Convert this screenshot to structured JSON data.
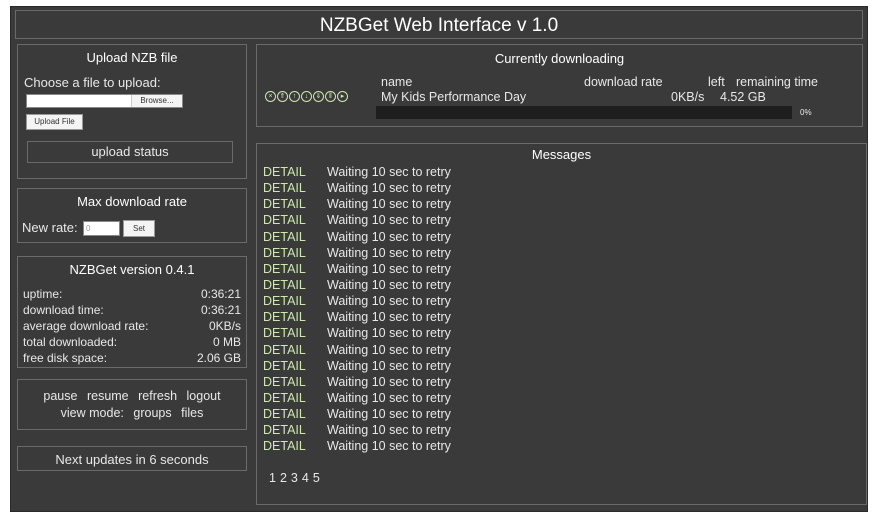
{
  "title": "NZBGet Web Interface v 1.0",
  "upload": {
    "title": "Upload NZB file",
    "choose_label": "Choose a file to upload:",
    "browse_label": "Browse...",
    "upload_button": "Upload File",
    "status": "upload status"
  },
  "rate": {
    "title": "Max download rate",
    "label": "New rate:",
    "value": "0",
    "set_button": "Set"
  },
  "stats": {
    "title": "NZBGet version 0.4.1",
    "rows": [
      {
        "label": "uptime:",
        "value": "0:36:21"
      },
      {
        "label": "download time:",
        "value": "0:36:21"
      },
      {
        "label": "average download rate:",
        "value": "0KB/s"
      },
      {
        "label": "total downloaded:",
        "value": "0 MB"
      },
      {
        "label": "free disk space:",
        "value": "2.06 GB"
      }
    ]
  },
  "actions": {
    "pause": "pause",
    "resume": "resume",
    "refresh": "refresh",
    "logout": "logout",
    "view_mode_label": "view mode:",
    "groups": "groups",
    "files": "files"
  },
  "updates": "Next updates in 6 seconds",
  "download": {
    "title": "Currently downloading",
    "col_name": "name",
    "col_rate": "download rate",
    "col_left": "left",
    "col_time": "remaining time",
    "item": {
      "name": "My Kids Performance Day",
      "rate": "0KB/s",
      "left": "4.52 GB",
      "progress_label": "0%",
      "progress": 0
    },
    "icons": [
      "cancel-icon",
      "move-top-icon",
      "move-up-icon",
      "move-down-icon",
      "move-bottom-icon",
      "pause-icon",
      "resume-icon"
    ]
  },
  "messages": {
    "title": "Messages",
    "items": [
      {
        "kind": "DETAIL",
        "text": "Waiting 10 sec to retry"
      },
      {
        "kind": "DETAIL",
        "text": "Waiting 10 sec to retry"
      },
      {
        "kind": "DETAIL",
        "text": "Waiting 10 sec to retry"
      },
      {
        "kind": "DETAIL",
        "text": "Waiting 10 sec to retry"
      },
      {
        "kind": "DETAIL",
        "text": "Waiting 10 sec to retry"
      },
      {
        "kind": "DETAIL",
        "text": "Waiting 10 sec to retry"
      },
      {
        "kind": "DETAIL",
        "text": "Waiting 10 sec to retry"
      },
      {
        "kind": "DETAIL",
        "text": "Waiting 10 sec to retry"
      },
      {
        "kind": "DETAIL",
        "text": "Waiting 10 sec to retry"
      },
      {
        "kind": "DETAIL",
        "text": "Waiting 10 sec to retry"
      },
      {
        "kind": "DETAIL",
        "text": "Waiting 10 sec to retry"
      },
      {
        "kind": "DETAIL",
        "text": "Waiting 10 sec to retry"
      },
      {
        "kind": "DETAIL",
        "text": "Waiting 10 sec to retry"
      },
      {
        "kind": "DETAIL",
        "text": "Waiting 10 sec to retry"
      },
      {
        "kind": "DETAIL",
        "text": "Waiting 10 sec to retry"
      },
      {
        "kind": "DETAIL",
        "text": "Waiting 10 sec to retry"
      },
      {
        "kind": "DETAIL",
        "text": "Waiting 10 sec to retry"
      },
      {
        "kind": "DETAIL",
        "text": "Waiting 10 sec to retry"
      }
    ],
    "pages": [
      "1",
      "2",
      "3",
      "4",
      "5"
    ]
  },
  "colors": {
    "background": "#3a3a3a",
    "border": "#6a6a6a",
    "accent": "#cfe7b0",
    "progress_track": "#1e1e1e"
  }
}
